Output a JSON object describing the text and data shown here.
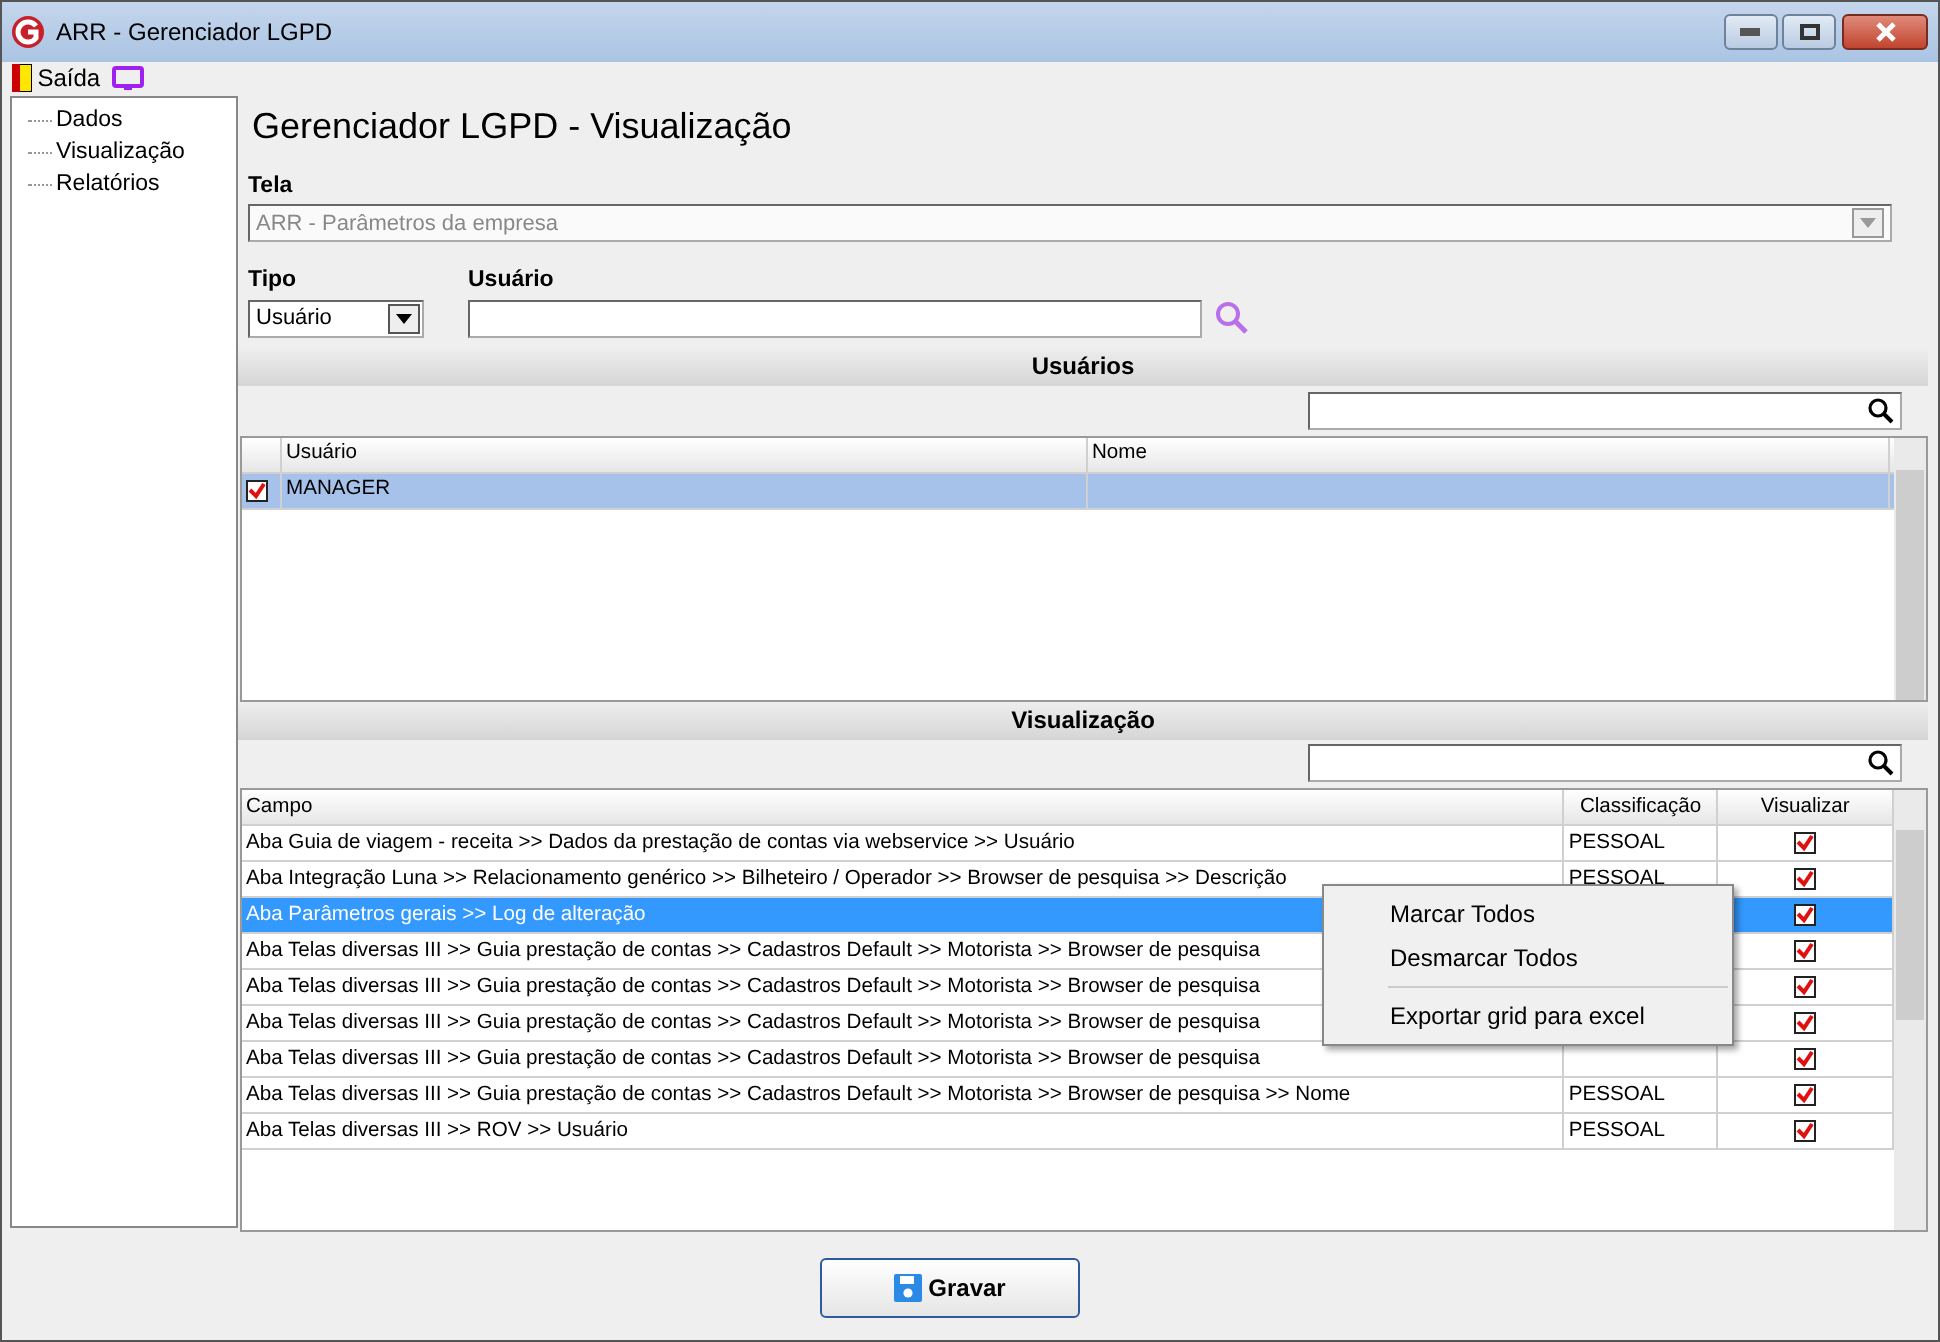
{
  "window": {
    "title": "ARR - Gerenciador LGPD"
  },
  "toolbar": [
    {
      "kind": "exit",
      "label": "Saída"
    },
    {
      "kind": "screen"
    }
  ],
  "sidebar": {
    "items": [
      {
        "label": "Dados"
      },
      {
        "label": "Visualização"
      },
      {
        "label": "Relatórios"
      }
    ]
  },
  "heading": "Gerenciador LGPD - Visualização",
  "tela": {
    "label": "Tela",
    "value": "ARR - Parâmetros da empresa",
    "disabled": true
  },
  "tipo": {
    "label": "Tipo",
    "value": "Usuário"
  },
  "usuario": {
    "label": "Usuário"
  },
  "users_section": {
    "title": "Usuários",
    "columns": [
      "Usuário",
      "Nome"
    ],
    "rows": [
      {
        "usuario": "MANAGER",
        "checked": true,
        "selected": true
      }
    ]
  },
  "view_section": {
    "title": "Visualização",
    "columns": [
      "Campo",
      "Classificação",
      "Visualizar"
    ],
    "rows": [
      {
        "campo": "Aba Guia de viagem - receita >> Dados da prestação de contas via webservice >> Usuário",
        "classificacao": "PESSOAL",
        "visualizar": true,
        "selected": false
      },
      {
        "campo": "Aba Integração Luna >> Relacionamento genérico >> Bilheteiro / Operador >> Browser de pesquisa >> Descrição",
        "classificacao": "PESSOAL",
        "visualizar": true,
        "selected": false
      },
      {
        "campo": "Aba Parâmetros gerais >> Log de alteração",
        "visualizar": true,
        "selected": true
      },
      {
        "campo": "Aba Telas diversas III >> Guia prestação de contas >> Cadastros Default >> Motorista >> Browser de pesquisa",
        "visualizar": true,
        "selected": false
      },
      {
        "campo": "Aba Telas diversas III >> Guia prestação de contas >> Cadastros Default >> Motorista >> Browser de pesquisa",
        "visualizar": true,
        "selected": false
      },
      {
        "campo": "Aba Telas diversas III >> Guia prestação de contas >> Cadastros Default >> Motorista >> Browser de pesquisa",
        "visualizar": true,
        "selected": false
      },
      {
        "campo": "Aba Telas diversas III >> Guia prestação de contas >> Cadastros Default >> Motorista >> Browser de pesquisa",
        "visualizar": true,
        "selected": false
      },
      {
        "campo": "Aba Telas diversas III >> Guia prestação de contas >> Cadastros Default >> Motorista >> Browser de pesquisa >> Nome",
        "classificacao": "PESSOAL",
        "visualizar": true,
        "selected": false
      },
      {
        "campo": "Aba Telas diversas III >> ROV >> Usuário",
        "classificacao": "PESSOAL",
        "visualizar": true,
        "selected": false
      }
    ]
  },
  "context_menu": [
    {
      "kind": "item",
      "label": "Marcar Todos"
    },
    {
      "kind": "item",
      "label": "Desmarcar Todos"
    },
    {
      "kind": "separator"
    },
    {
      "kind": "item",
      "label": "Exportar grid para excel"
    }
  ],
  "save_button": {
    "label": "Gravar"
  }
}
